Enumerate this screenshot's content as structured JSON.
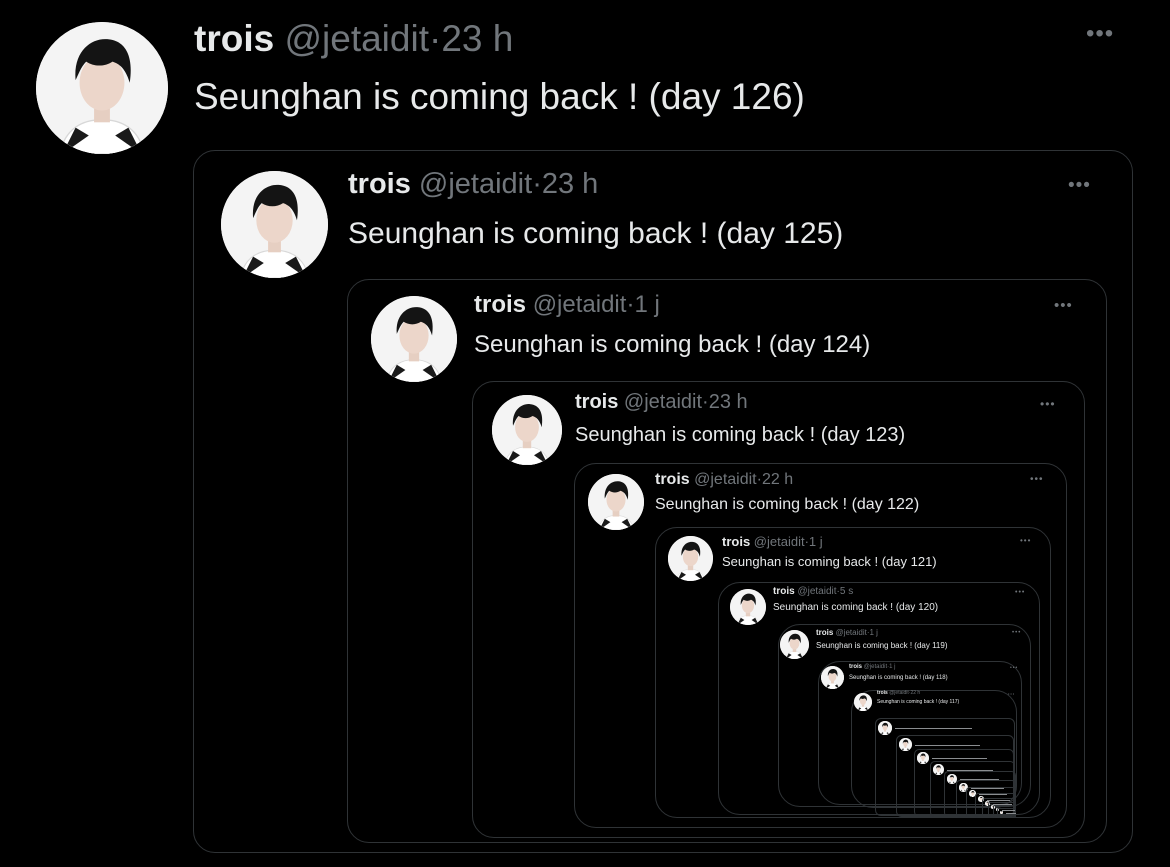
{
  "tweets": [
    {
      "name": "trois",
      "handle": "@jetaidit",
      "time": "23 h",
      "text": "Seunghan is coming back ! (day 126)"
    },
    {
      "name": "trois",
      "handle": "@jetaidit",
      "time": "23 h",
      "text": "Seunghan is coming back ! (day 125)"
    },
    {
      "name": "trois",
      "handle": "@jetaidit",
      "time": "1 j",
      "text": "Seunghan is coming back ! (day 124)"
    },
    {
      "name": "trois",
      "handle": "@jetaidit",
      "time": "23 h",
      "text": "Seunghan is coming back ! (day 123)"
    },
    {
      "name": "trois",
      "handle": "@jetaidit",
      "time": "22 h",
      "text": "Seunghan is coming back ! (day 122)"
    },
    {
      "name": "trois",
      "handle": "@jetaidit",
      "time": "1 j",
      "text": "Seunghan is coming back ! (day 121)"
    },
    {
      "name": "trois",
      "handle": "@jetaidit",
      "time": "5 s",
      "text": "Seunghan is coming back ! (day 120)"
    },
    {
      "name": "trois",
      "handle": "@jetaidit",
      "time": "1 j",
      "text": "Seunghan is coming back ! (day 119)"
    },
    {
      "name": "trois",
      "handle": "@jetaidit",
      "time": "1 j",
      "text": "Seunghan is coming back ! (day 118)"
    },
    {
      "name": "trois",
      "handle": "@jetaidit",
      "time": "22 h",
      "text": "Seunghan is coming back ! (day 117)"
    }
  ],
  "ui": {
    "more_glyph": "•••",
    "separator": "·"
  },
  "icons": {
    "more": "more-options-icon",
    "avatar": "profile-avatar"
  },
  "colors": {
    "background": "#000000",
    "primary_text": "#e7e9ea",
    "secondary_text": "#71767b",
    "border": "#2f3336"
  }
}
